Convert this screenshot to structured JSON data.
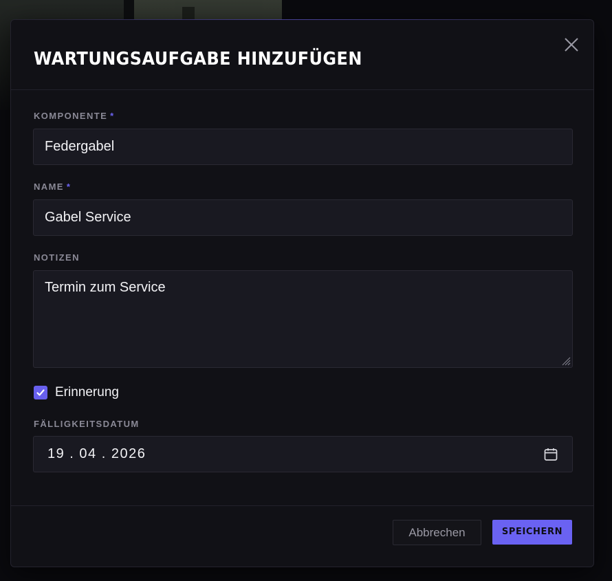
{
  "dialog": {
    "title": "WARTUNGSAUFGABE HINZUFÜGEN",
    "close_icon": "close-icon"
  },
  "form": {
    "component": {
      "label": "KOMPONENTE",
      "required_marker": "*",
      "value": "Federgabel"
    },
    "name": {
      "label": "NAME",
      "required_marker": "*",
      "value": "Gabel Service"
    },
    "notes": {
      "label": "NOTIZEN",
      "value": "Termin zum Service"
    },
    "reminder": {
      "label": "Erinnerung",
      "checked": true
    },
    "due_date": {
      "label": "FÄLLIGKEITSDATUM",
      "value": "19.04.2026",
      "icon": "calendar-icon"
    }
  },
  "footer": {
    "cancel_label": "Abbrechen",
    "save_label": "SPEICHERN"
  },
  "colors": {
    "accent": "#6a62f2",
    "modal_bg": "#111116",
    "input_bg": "#191921"
  }
}
